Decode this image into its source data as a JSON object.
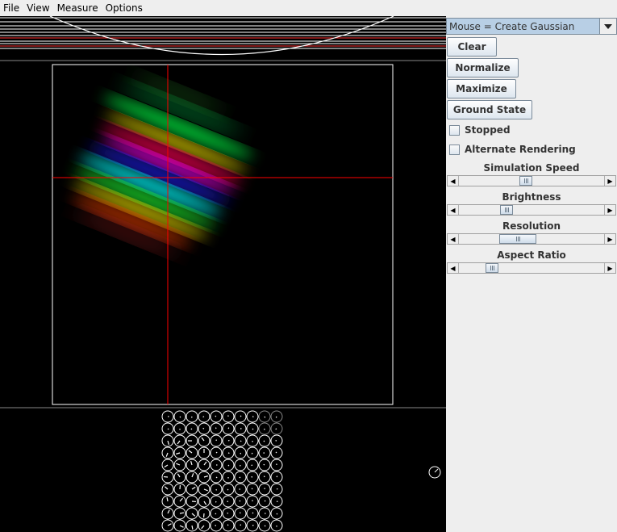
{
  "menu": [
    "File",
    "View",
    "Measure",
    "Options"
  ],
  "mouse_mode": "Mouse = Create Gaussian",
  "buttons": {
    "clear": "Clear",
    "normalize": "Normalize",
    "maximize": "Maximize",
    "ground_state": "Ground State"
  },
  "checkboxes": {
    "stopped": {
      "label": "Stopped",
      "checked": false
    },
    "alternate_rendering": {
      "label": "Alternate Rendering",
      "checked": false
    }
  },
  "sliders": [
    {
      "label": "Simulation Speed",
      "fraction": 0.46
    },
    {
      "label": "Brightness",
      "fraction": 0.31
    },
    {
      "label": "Resolution",
      "fraction": 0.37
    },
    {
      "label": "Aspect Ratio",
      "fraction": 0.2
    }
  ],
  "colors": {
    "canvas_bg": "#000000",
    "crosshair": "#ff0000",
    "panel_bg": "#eeeeee",
    "select_bg": "#b8cfe5"
  },
  "phasor_grid": {
    "rows": 10,
    "cols": 10
  }
}
